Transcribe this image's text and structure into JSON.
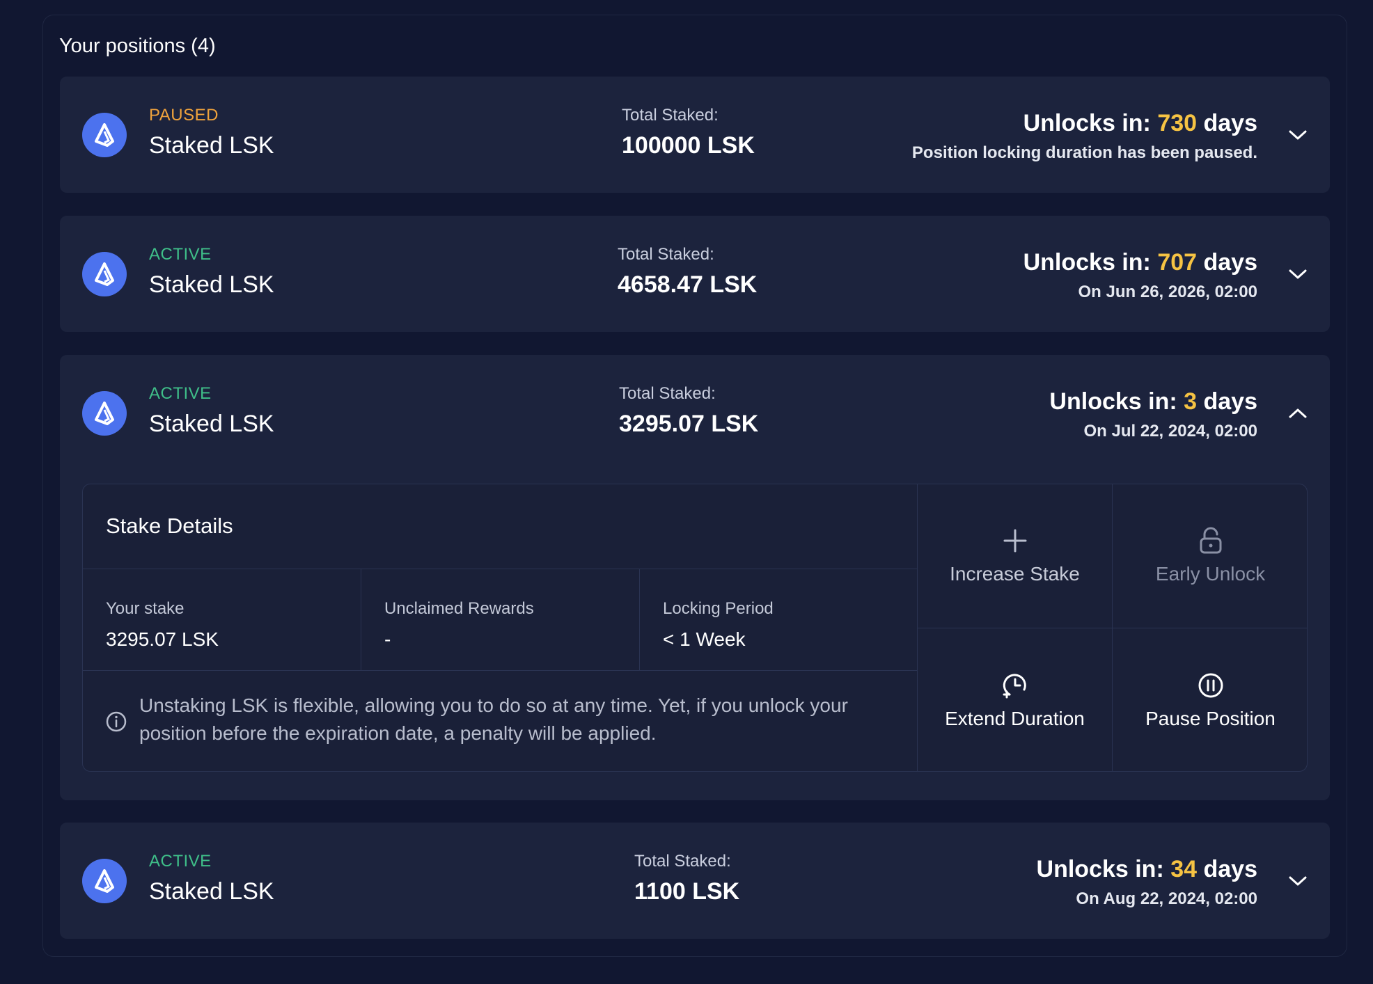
{
  "panel": {
    "title": "Your positions (4)"
  },
  "positions": [
    {
      "status": "PAUSED",
      "name": "Staked LSK",
      "total_label": "Total Staked:",
      "total_value": "100000 LSK",
      "unlock_prefix": "Unlocks in:",
      "unlock_days": "730",
      "unlock_suffix": "days",
      "unlock_sub": "Position locking duration has been paused."
    },
    {
      "status": "ACTIVE",
      "name": "Staked LSK",
      "total_label": "Total Staked:",
      "total_value": "4658.47 LSK",
      "unlock_prefix": "Unlocks in:",
      "unlock_days": "707",
      "unlock_suffix": "days",
      "unlock_sub": "On Jun 26, 2026, 02:00"
    },
    {
      "status": "ACTIVE",
      "name": "Staked LSK",
      "total_label": "Total Staked:",
      "total_value": "3295.07 LSK",
      "unlock_prefix": "Unlocks in:",
      "unlock_days": "3",
      "unlock_suffix": "days",
      "unlock_sub": "On Jul 22, 2024, 02:00"
    },
    {
      "status": "ACTIVE",
      "name": "Staked LSK",
      "total_label": "Total Staked:",
      "total_value": "1100 LSK",
      "unlock_prefix": "Unlocks in:",
      "unlock_days": "34",
      "unlock_suffix": "days",
      "unlock_sub": "On Aug 22, 2024, 02:00"
    }
  ],
  "details": {
    "title": "Stake Details",
    "your_stake_label": "Your stake",
    "your_stake_value": "3295.07 LSK",
    "rewards_label": "Unclaimed Rewards",
    "rewards_value": "-",
    "locking_label": "Locking Period",
    "locking_value": "< 1 Week",
    "info_text": "Unstaking LSK is flexible, allowing you to do so at any time. Yet, if you unlock your position before the expiration date, a penalty will be applied.",
    "actions": {
      "increase": "Increase Stake",
      "early_unlock": "Early Unlock",
      "extend": "Extend Duration",
      "pause": "Pause Position"
    }
  },
  "colors": {
    "background": "#111731",
    "card": "#1c233d",
    "paused": "#f0a33c",
    "active": "#3fbf89",
    "days_highlight": "#f6c343",
    "logo": "#4c72ee"
  },
  "icons": {
    "logo": "lisk-logo-icon",
    "expand": "chevron-down-icon",
    "collapse": "chevron-up-icon",
    "info": "info-icon",
    "plus": "plus-icon",
    "lock": "unlock-icon",
    "clock": "clock-plus-icon",
    "pause": "pause-circle-icon"
  }
}
